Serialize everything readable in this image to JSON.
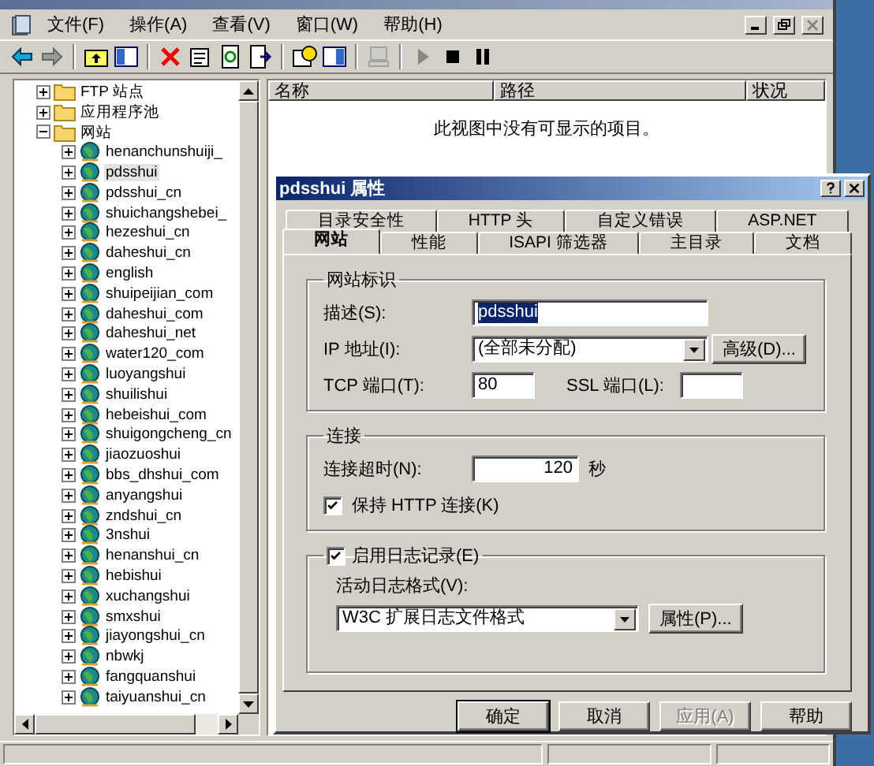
{
  "menu": [
    {
      "label": "文件(F)"
    },
    {
      "label": "操作(A)"
    },
    {
      "label": "查看(V)"
    },
    {
      "label": "窗口(W)"
    },
    {
      "label": "帮助(H)"
    }
  ],
  "tree": [
    {
      "label": "FTP 站点",
      "kind": "folder",
      "expanded": false,
      "selected": false
    },
    {
      "label": "应用程序池",
      "kind": "folder",
      "expanded": false,
      "selected": false
    },
    {
      "label": "网站",
      "kind": "folder",
      "expanded": true,
      "selected": false,
      "children": [
        {
          "label": "henanchunshuiji_",
          "kind": "site",
          "expanded": false,
          "selected": false
        },
        {
          "label": "pdsshui",
          "kind": "site",
          "expanded": false,
          "selected": true
        },
        {
          "label": "pdsshui_cn",
          "kind": "site",
          "expanded": false,
          "selected": false
        },
        {
          "label": "shuichangshebei_",
          "kind": "site",
          "expanded": false,
          "selected": false
        },
        {
          "label": "hezeshui_cn",
          "kind": "site",
          "expanded": false,
          "selected": false
        },
        {
          "label": "daheshui_cn",
          "kind": "site",
          "expanded": false,
          "selected": false
        },
        {
          "label": "english",
          "kind": "site",
          "expanded": false,
          "selected": false
        },
        {
          "label": "shuipeijian_com",
          "kind": "site",
          "expanded": false,
          "selected": false
        },
        {
          "label": "daheshui_com",
          "kind": "site",
          "expanded": false,
          "selected": false
        },
        {
          "label": "daheshui_net",
          "kind": "site",
          "expanded": false,
          "selected": false
        },
        {
          "label": "water120_com",
          "kind": "site",
          "expanded": false,
          "selected": false
        },
        {
          "label": "luoyangshui",
          "kind": "site",
          "expanded": false,
          "selected": false
        },
        {
          "label": "shuilishui",
          "kind": "site",
          "expanded": false,
          "selected": false
        },
        {
          "label": "hebeishui_com",
          "kind": "site",
          "expanded": false,
          "selected": false
        },
        {
          "label": "shuigongcheng_cn",
          "kind": "site",
          "expanded": false,
          "selected": false
        },
        {
          "label": "jiaozuoshui",
          "kind": "site",
          "expanded": false,
          "selected": false
        },
        {
          "label": "bbs_dhshui_com",
          "kind": "site",
          "expanded": false,
          "selected": false
        },
        {
          "label": "anyangshui",
          "kind": "site",
          "expanded": false,
          "selected": false
        },
        {
          "label": "zndshui_cn",
          "kind": "site",
          "expanded": false,
          "selected": false
        },
        {
          "label": "3nshui",
          "kind": "site",
          "expanded": false,
          "selected": false
        },
        {
          "label": "henanshui_cn",
          "kind": "site",
          "expanded": false,
          "selected": false
        },
        {
          "label": "hebishui",
          "kind": "site",
          "expanded": false,
          "selected": false
        },
        {
          "label": "xuchangshui",
          "kind": "site",
          "expanded": false,
          "selected": false
        },
        {
          "label": "smxshui",
          "kind": "site",
          "expanded": false,
          "selected": false
        },
        {
          "label": "jiayongshui_cn",
          "kind": "site",
          "expanded": false,
          "selected": false
        },
        {
          "label": "nbwkj",
          "kind": "site",
          "expanded": false,
          "selected": false
        },
        {
          "label": "fangquanshui",
          "kind": "site",
          "expanded": false,
          "selected": false
        },
        {
          "label": "taiyuanshui_cn",
          "kind": "site",
          "expanded": false,
          "selected": false
        }
      ]
    }
  ],
  "list": {
    "columns": [
      "名称",
      "路径",
      "状况"
    ],
    "empty_message": "此视图中没有可显示的项目。"
  },
  "dialog": {
    "title": "pdsshui 属性",
    "tab_rows": [
      [
        {
          "label": "目录安全性",
          "selected": false
        },
        {
          "label": "HTTP 头",
          "selected": false
        },
        {
          "label": "自定义错误",
          "selected": false
        },
        {
          "label": "ASP.NET",
          "selected": false
        }
      ],
      [
        {
          "label": "网站",
          "selected": true
        },
        {
          "label": "性能",
          "selected": false
        },
        {
          "label": "ISAPI 筛选器",
          "selected": false
        },
        {
          "label": "主目录",
          "selected": false
        },
        {
          "label": "文档",
          "selected": false
        }
      ]
    ],
    "identification": {
      "legend": "网站标识",
      "description": {
        "label": "描述(S):",
        "value": "pdsshui",
        "text_selected": true
      },
      "ip": {
        "label": "IP 地址(I):",
        "value": "(全部未分配)"
      },
      "advanced_button": "高级(D)...",
      "tcp_port": {
        "label": "TCP 端口(T):",
        "value": "80"
      },
      "ssl_port": {
        "label": "SSL 端口(L):"
      }
    },
    "connection": {
      "legend": "连接",
      "timeout": {
        "label": "连接超时(N):",
        "value": "120",
        "unit": "秒"
      },
      "keep_alive": {
        "label": "保持 HTTP 连接(K)",
        "checked": true
      }
    },
    "logging": {
      "enable": {
        "label": "启用日志记录(E)",
        "checked": true
      },
      "format_label": "活动日志格式(V):",
      "format": "W3C 扩展日志文件格式",
      "properties_button": "属性(P)..."
    },
    "buttons": [
      {
        "label": "确定",
        "disabled": false,
        "default": true
      },
      {
        "label": "取消",
        "disabled": false,
        "default": false
      },
      {
        "label": "应用(A)",
        "disabled": true,
        "default": false
      },
      {
        "label": "帮助",
        "disabled": false,
        "default": false
      }
    ]
  }
}
